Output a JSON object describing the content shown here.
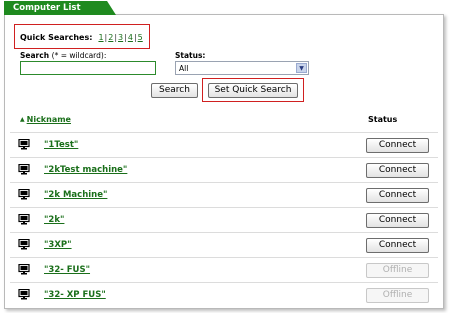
{
  "tab_title": "Computer List",
  "quick_searches": {
    "label": "Quick Searches:",
    "links": [
      "1",
      "2",
      "3",
      "4",
      "5"
    ]
  },
  "search": {
    "label": "Search",
    "hint": "(* = wildcard):",
    "value": ""
  },
  "status_filter": {
    "label": "Status:",
    "selected": "All"
  },
  "buttons": {
    "search": "Search",
    "set_quick_search": "Set Quick Search"
  },
  "table": {
    "col_nickname": "Nickname",
    "col_status": "Status",
    "rows": [
      {
        "name": "\"1Test\"",
        "action": "Connect",
        "enabled": true
      },
      {
        "name": "\"2kTest machine\"",
        "action": "Connect",
        "enabled": true
      },
      {
        "name": "\"2k Machine\"",
        "action": "Connect",
        "enabled": true
      },
      {
        "name": "\"2k\"",
        "action": "Connect",
        "enabled": true
      },
      {
        "name": "\"3XP\"",
        "action": "Connect",
        "enabled": true
      },
      {
        "name": "\"32- FUS\"",
        "action": "Offline",
        "enabled": false
      },
      {
        "name": "\"32- XP FUS\"",
        "action": "Offline",
        "enabled": false
      }
    ]
  },
  "colors": {
    "accent": "#1f8a1f",
    "link": "#1a6f1a",
    "highlight": "#d02020"
  },
  "icons": {
    "row": "computer-monitor-icon",
    "sort": "sort-ascending-icon",
    "dropdown": "chevron-down-icon"
  }
}
